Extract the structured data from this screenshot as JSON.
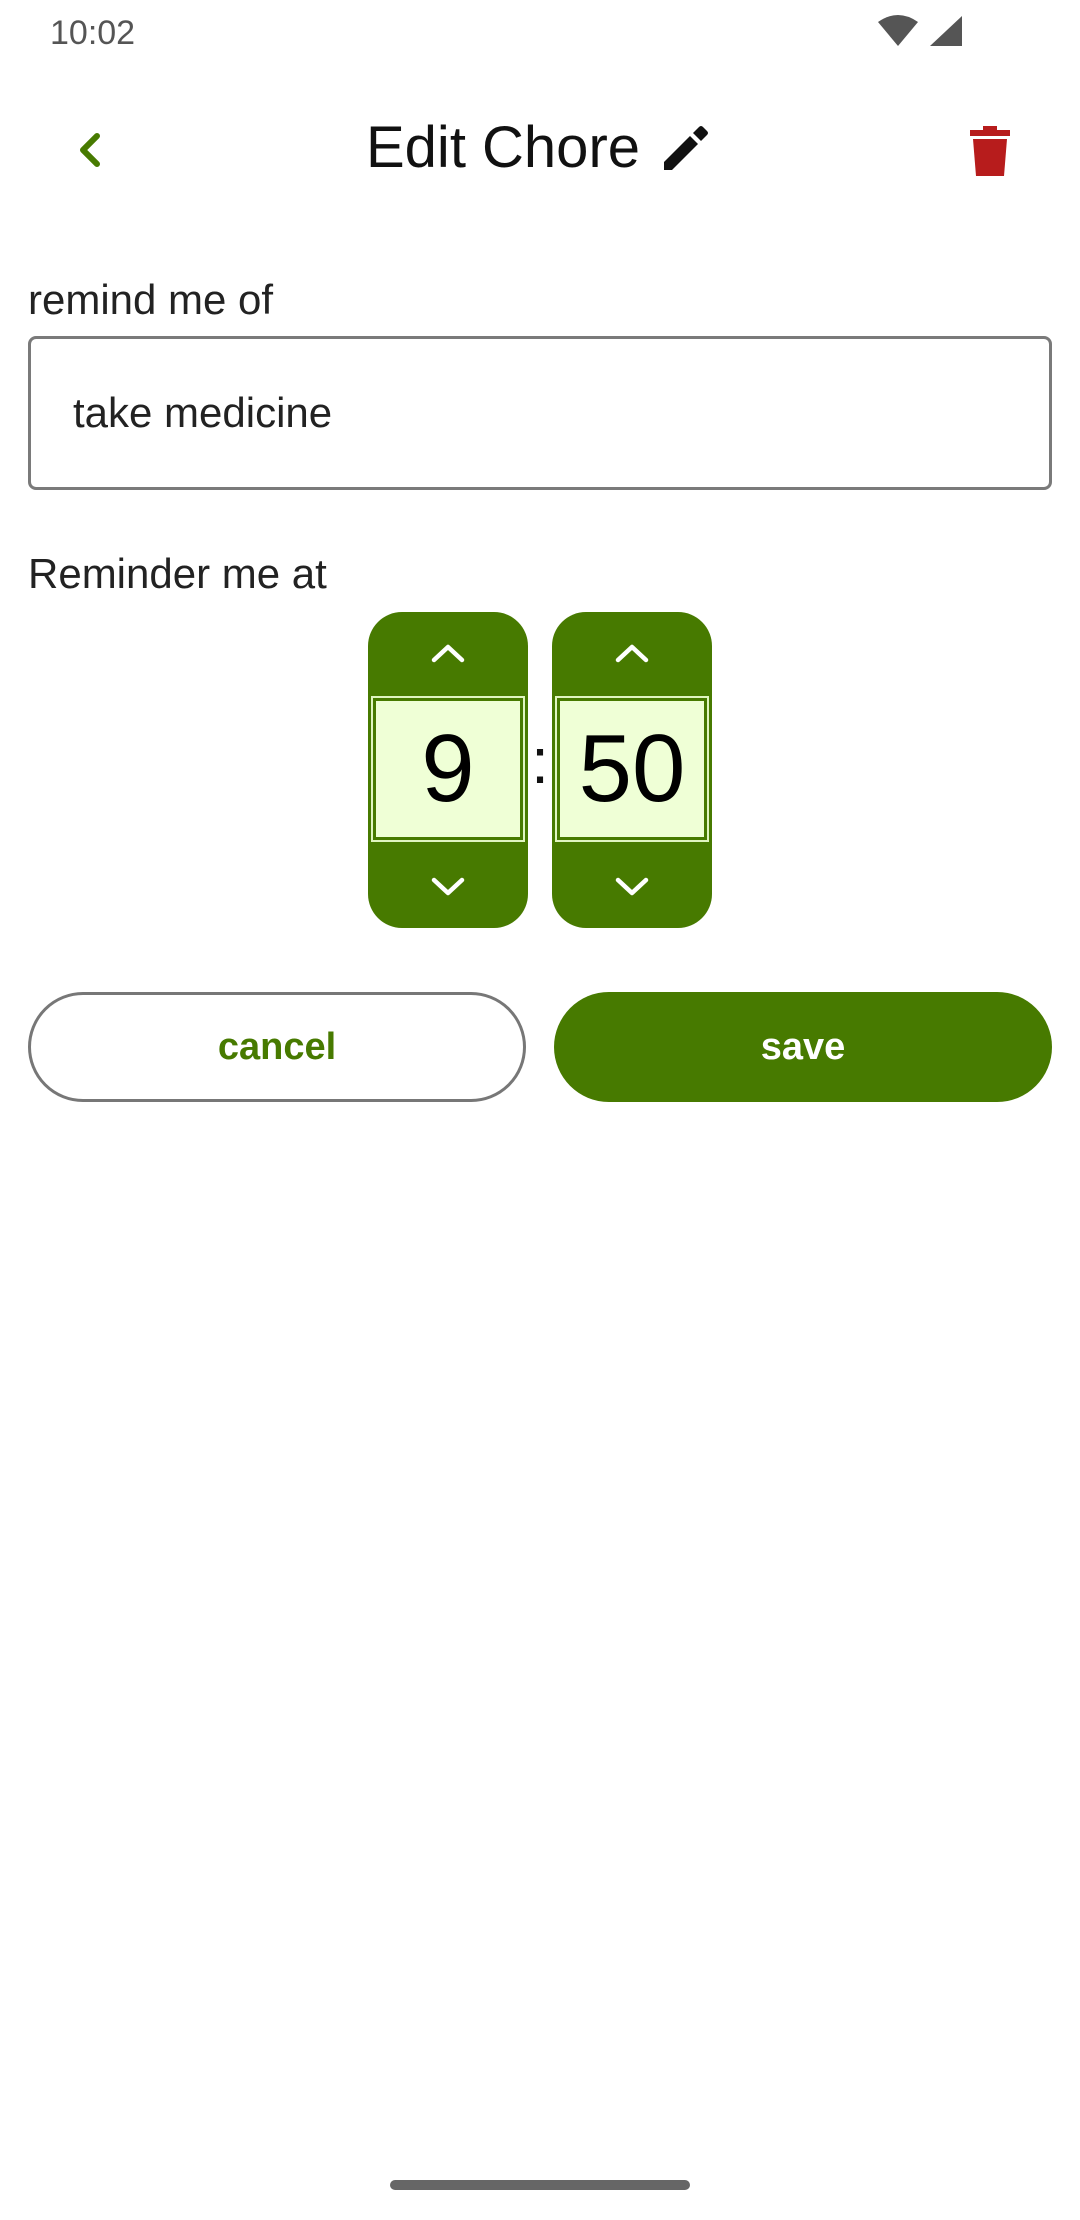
{
  "status_bar": {
    "time": "10:02",
    "icons": [
      "wifi-icon",
      "cellular-signal-icon"
    ]
  },
  "header": {
    "title": "Edit Chore",
    "icons": {
      "back": "chevron-left-icon",
      "edit": "pencil-icon",
      "delete": "trash-icon"
    }
  },
  "form": {
    "reminder_label": "remind me of",
    "reminder_value": "take medicine",
    "time_label": "Reminder me at"
  },
  "time_picker": {
    "hour": "9",
    "separator": ":",
    "minute": "50"
  },
  "actions": {
    "cancel_label": "cancel",
    "save_label": "save"
  },
  "colors": {
    "accent": "#477a00",
    "spinner_value_bg": "#efffd6",
    "delete": "#b71c1c"
  }
}
